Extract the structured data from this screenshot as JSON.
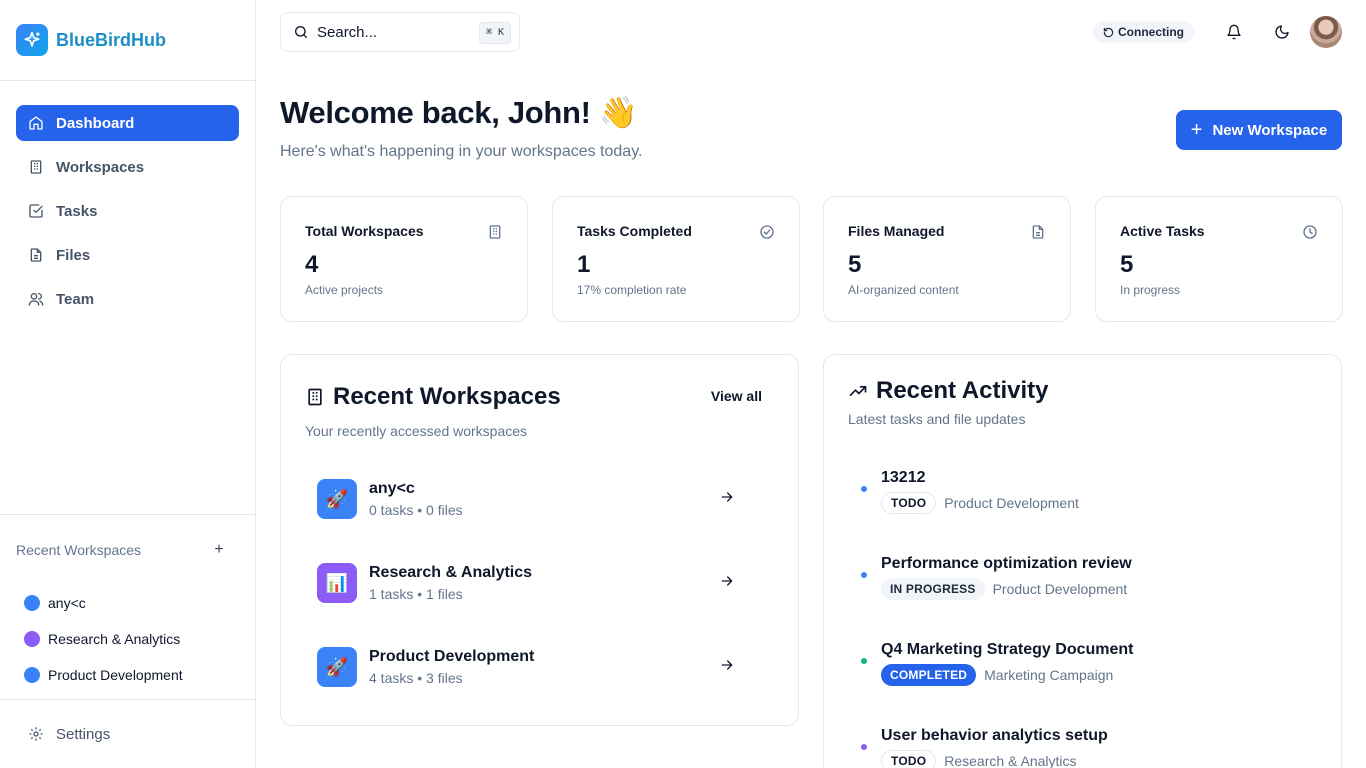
{
  "app": {
    "name": "BlueBirdHub"
  },
  "sidebar": {
    "nav": [
      {
        "label": "Dashboard",
        "icon": "home-icon",
        "active": true
      },
      {
        "label": "Workspaces",
        "icon": "building-icon",
        "active": false
      },
      {
        "label": "Tasks",
        "icon": "check-square-icon",
        "active": false
      },
      {
        "label": "Files",
        "icon": "file-icon",
        "active": false
      },
      {
        "label": "Team",
        "icon": "users-icon",
        "active": false
      }
    ],
    "recent_title": "Recent Workspaces",
    "recent_add": "+",
    "recent": [
      {
        "label": "any<c",
        "color": "#3b82f6"
      },
      {
        "label": "Research & Analytics",
        "color": "#8b5cf6"
      },
      {
        "label": "Product Development",
        "color": "#3b82f6"
      }
    ],
    "settings_label": "Settings"
  },
  "topbar": {
    "search_placeholder": "Search...",
    "search_shortcut": "⌘ K",
    "connection_status": "Connecting"
  },
  "header": {
    "welcome": "Welcome back, John! 👋",
    "subtitle": "Here's what's happening in your workspaces today.",
    "new_workspace": "New Workspace"
  },
  "stats": [
    {
      "title": "Total Workspaces",
      "value": "4",
      "sub": "Active projects",
      "icon": "building-icon"
    },
    {
      "title": "Tasks Completed",
      "value": "1",
      "sub": "17% completion rate",
      "icon": "check-circle-icon"
    },
    {
      "title": "Files Managed",
      "value": "5",
      "sub": "AI-organized content",
      "icon": "file-text-icon"
    },
    {
      "title": "Active Tasks",
      "value": "5",
      "sub": "In progress",
      "icon": "clock-icon"
    }
  ],
  "recent_workspaces": {
    "title": "Recent Workspaces",
    "subtitle": "Your recently accessed workspaces",
    "view_all": "View all",
    "items": [
      {
        "name": "any<c",
        "meta": "0 tasks • 0 files",
        "emoji": "🚀",
        "color": "#3b82f6"
      },
      {
        "name": "Research & Analytics",
        "meta": "1 tasks • 1 files",
        "emoji": "📊",
        "color": "#8b5cf6"
      },
      {
        "name": "Product Development",
        "meta": "4 tasks • 3 files",
        "emoji": "🚀",
        "color": "#3b82f6"
      }
    ]
  },
  "recent_activity": {
    "title": "Recent Activity",
    "subtitle": "Latest tasks and file updates",
    "items": [
      {
        "title": "13212",
        "status": "TODO",
        "status_type": "todo",
        "workspace": "Product Development",
        "dot": "#3b82f6"
      },
      {
        "title": "Performance optimization review",
        "status": "IN PROGRESS",
        "status_type": "prog",
        "workspace": "Product Development",
        "dot": "#3b82f6"
      },
      {
        "title": "Q4 Marketing Strategy Document",
        "status": "COMPLETED",
        "status_type": "done",
        "workspace": "Marketing Campaign",
        "dot": "#10b981"
      },
      {
        "title": "User behavior analytics setup",
        "status": "TODO",
        "status_type": "todo",
        "workspace": "Research & Analytics",
        "dot": "#8b5cf6"
      }
    ]
  }
}
